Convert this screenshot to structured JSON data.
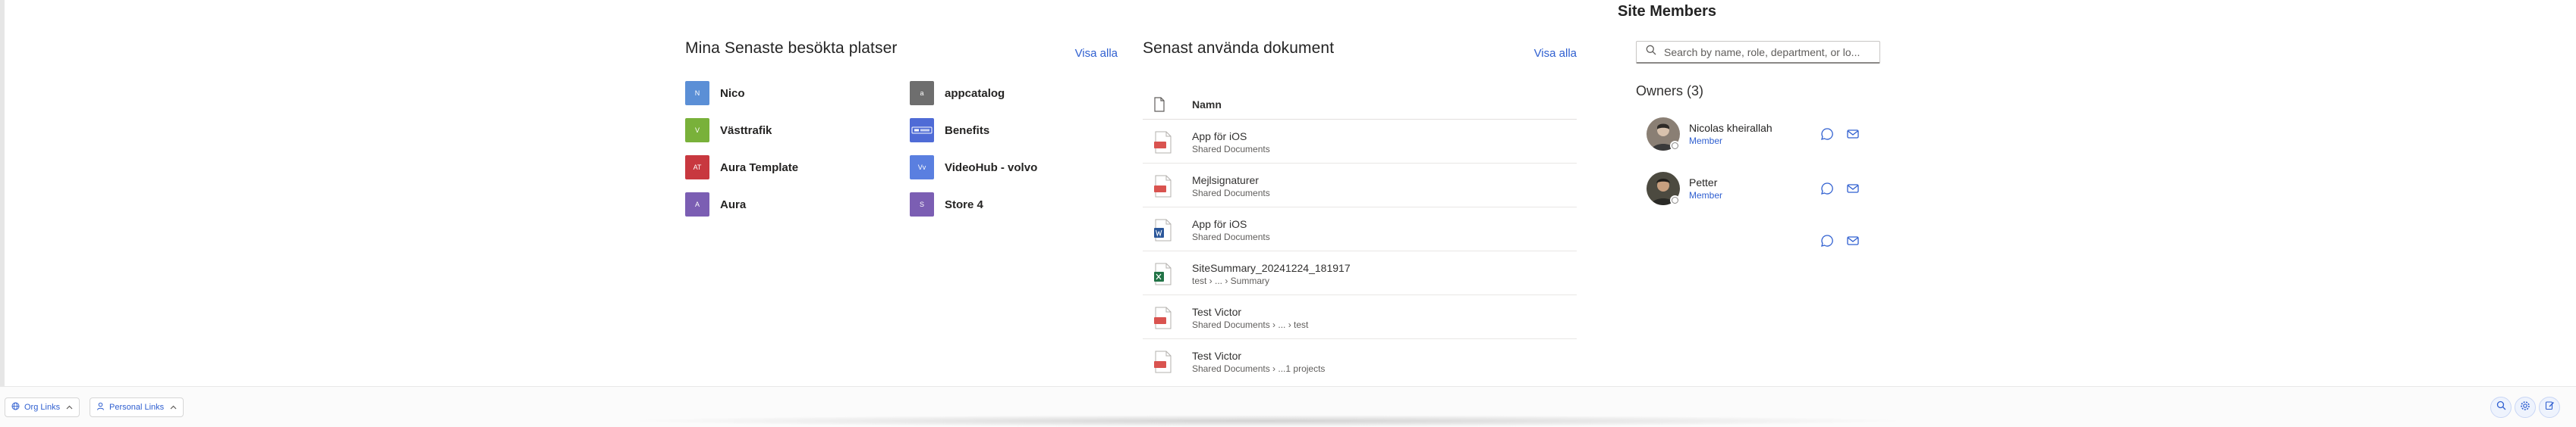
{
  "recent_sites": {
    "title": "Mina Senaste besökta platser",
    "see_all": "Visa alla",
    "items": [
      {
        "initials": "N",
        "name": "Nico",
        "color": "#5b8fd6"
      },
      {
        "initials": "a",
        "name": "appcatalog",
        "color": "#6e6e6e"
      },
      {
        "initials": "V",
        "name": "Västtrafik",
        "color": "#79b13a"
      },
      {
        "initials": "",
        "name": "Benefits",
        "color": "#4f6bd6"
      },
      {
        "initials": "AT",
        "name": "Aura Template",
        "color": "#c8383f"
      },
      {
        "initials": "Vv",
        "name": "VideoHub - volvo",
        "color": "#5a7fe0"
      },
      {
        "initials": "A",
        "name": "Aura",
        "color": "#7b5eb3"
      },
      {
        "initials": "S",
        "name": "Store 4",
        "color": "#7b5eb3"
      }
    ]
  },
  "recent_docs": {
    "title": "Senast använda dokument",
    "see_all": "Visa alla",
    "column_header": "Namn",
    "items": [
      {
        "title": "App för iOS",
        "path": "Shared Documents",
        "type": "pdf"
      },
      {
        "title": "Mejlsignaturer",
        "path": "Shared Documents",
        "type": "pdf"
      },
      {
        "title": "App för iOS",
        "path": "Shared Documents",
        "type": "word"
      },
      {
        "title": "SiteSummary_20241224_181917",
        "path": "test › ... › Summary",
        "type": "excel"
      },
      {
        "title": "Test Victor",
        "path": "Shared Documents › ... › test",
        "type": "pdf"
      },
      {
        "title": "Test Victor",
        "path": "Shared Documents › ...1 projects",
        "type": "pdf"
      }
    ]
  },
  "site_members": {
    "title": "Site Members",
    "search_placeholder": "Search by name, role, department, or lo...",
    "owners_label": "Owners (3)",
    "members": [
      {
        "name": "Nicolas kheirallah",
        "role": "Member"
      },
      {
        "name": "Petter",
        "role": "Member"
      },
      {
        "name": "",
        "role": ""
      }
    ]
  },
  "bottom_bar": {
    "org_links": "Org Links",
    "personal_links": "Personal Links"
  },
  "colors": {
    "accent": "#2f5fd0",
    "pdf": "#d9534f",
    "word": "#2b579a",
    "excel": "#217346"
  }
}
